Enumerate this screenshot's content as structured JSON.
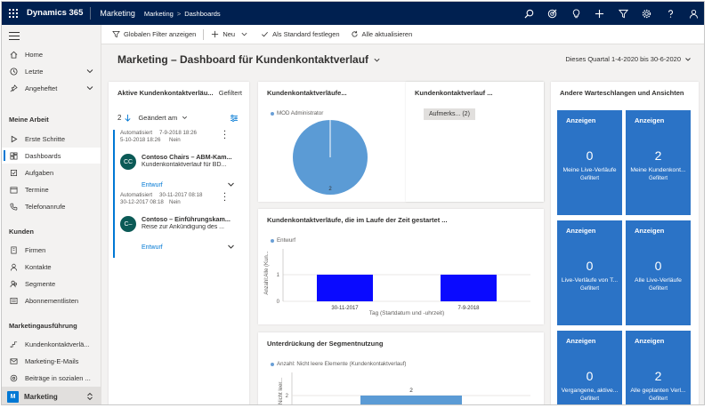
{
  "topbar": {
    "brand": "Dynamics 365",
    "app": "Marketing",
    "breadcrumb": [
      "Marketing",
      "Dashboards"
    ],
    "icons": [
      "search-icon",
      "target-icon",
      "lightbulb-icon",
      "plus-icon",
      "filter-icon",
      "gear-icon",
      "help-icon",
      "user-icon"
    ]
  },
  "sidebar": {
    "top_items": [
      {
        "label": "Home",
        "icon": "home-icon"
      },
      {
        "label": "Letzte",
        "icon": "clock-icon"
      },
      {
        "label": "Angeheftet",
        "icon": "pin-icon"
      }
    ],
    "section_work": "Meine Arbeit",
    "work_items": [
      {
        "label": "Erste Schritte",
        "icon": "play-icon"
      },
      {
        "label": "Dashboards",
        "icon": "dashboard-icon"
      },
      {
        "label": "Aufgaben",
        "icon": "task-icon"
      },
      {
        "label": "Termine",
        "icon": "calendar-icon"
      },
      {
        "label": "Telefonanrufe",
        "icon": "phone-icon"
      }
    ],
    "section_customers": "Kunden",
    "customer_items": [
      {
        "label": "Firmen",
        "icon": "building-icon"
      },
      {
        "label": "Kontakte",
        "icon": "person-icon"
      },
      {
        "label": "Segmente",
        "icon": "segment-icon"
      },
      {
        "label": "Abonnementlisten",
        "icon": "list-icon"
      }
    ],
    "section_marketing": "Marketingausführung",
    "marketing_items": [
      {
        "label": "Kundenkontaktverlä...",
        "icon": "journey-icon"
      },
      {
        "label": "Marketing-E-Mails",
        "icon": "mail-icon"
      },
      {
        "label": "Beiträge in sozialen ...",
        "icon": "social-icon"
      }
    ],
    "area": {
      "badge": "M",
      "label": "Marketing"
    }
  },
  "cmdbar": {
    "global_filter": "Globalen Filter anzeigen",
    "new": "Neu",
    "set_default": "Als Standard festlegen",
    "refresh_all": "Alle aktualisieren"
  },
  "header": {
    "title": "Marketing – Dashboard für Kundenkontaktverlauf",
    "period": "Dieses Quartal 1-4-2020 bis 30-6-2020"
  },
  "stream": {
    "title": "Aktive Kundenkontaktverläu...",
    "filter_label": "Gefiltert",
    "count": "2",
    "sort_label": "Geändert am",
    "records": [
      {
        "meta1_label": "Automatisiert",
        "meta1_value": "7-9-2018 18:26",
        "meta2_label": "5-10-2018 18:26",
        "meta2_value": "Nein",
        "initials": "CC",
        "title": "Contoso Chairs – ABM-Kam...",
        "subtitle": "Kundenkontaktverlauf für BD...",
        "status": "Entwurf"
      },
      {
        "meta1_label": "Automatisiert",
        "meta1_value": "30-11-2017 08:18",
        "meta2_label": "30-12-2017 08:18",
        "meta2_value": "Nein",
        "initials": "C–",
        "title": "Contoso – Einführungskam...",
        "subtitle": "Reise zur Ankündigung des ...",
        "status": "Entwurf"
      }
    ]
  },
  "chart_pie": {
    "title": "Kundenkontaktverläufe...",
    "chart_data": {
      "type": "pie",
      "legend": [
        "MOD Administrator"
      ],
      "values": [
        2
      ],
      "labels": [
        "2"
      ],
      "colors": [
        "#5b9bd5"
      ]
    }
  },
  "chart_journey": {
    "title": "Kundenkontaktverlauf ...",
    "pill": "Aufmerks... (2)"
  },
  "chart_bar": {
    "title": "Kundenkontaktverläufe, die im Laufe der Zeit gestartet ...",
    "chart_data": {
      "type": "bar",
      "legend": [
        "Entwurf"
      ],
      "categories": [
        "30-11-2017",
        "7-9-2018"
      ],
      "values": [
        1,
        1
      ],
      "ylim": [
        0,
        1
      ],
      "yticks": [
        "0",
        "1"
      ],
      "ylabel": "Anzahl:Alle (Kun...",
      "xlabel": "Tag (Startdatum und -uhrzeit)",
      "colors": [
        "#0a0aff"
      ]
    }
  },
  "chart_segment": {
    "title": "Unterdrückung der Segmentnutzung",
    "chart_data": {
      "type": "bar",
      "legend": [
        "Anzahl: Nicht leere Elemente (Kundenkontaktverlauf)"
      ],
      "values": [
        2
      ],
      "labels": [
        "2"
      ],
      "yticks": [
        "2"
      ],
      "ylabel": "Nicht leer...",
      "colors": [
        "#5b9bd5"
      ]
    }
  },
  "queues": {
    "title": "Andere Warteschlangen und Ansichten",
    "tiles": [
      {
        "head": "Anzeigen",
        "count": "0",
        "name": "Meine Live-Verläufe",
        "filter": "Gefiltert"
      },
      {
        "head": "Anzeigen",
        "count": "2",
        "name": "Meine Kundenkont...",
        "filter": "Gefiltert"
      },
      {
        "head": "Anzeigen",
        "count": "0",
        "name": "Live-Verläufe von T...",
        "filter": "Gefiltert"
      },
      {
        "head": "Anzeigen",
        "count": "0",
        "name": "Alle Live-Verläufe",
        "filter": "Gefiltert"
      },
      {
        "head": "Anzeigen",
        "count": "0",
        "name": "Vergangene, aktive...",
        "filter": "Gefiltert"
      },
      {
        "head": "Anzeigen",
        "count": "2",
        "name": "Alle geplanten Verl...",
        "filter": "Gefiltert"
      }
    ],
    "tile_color": "#2b73c6"
  }
}
